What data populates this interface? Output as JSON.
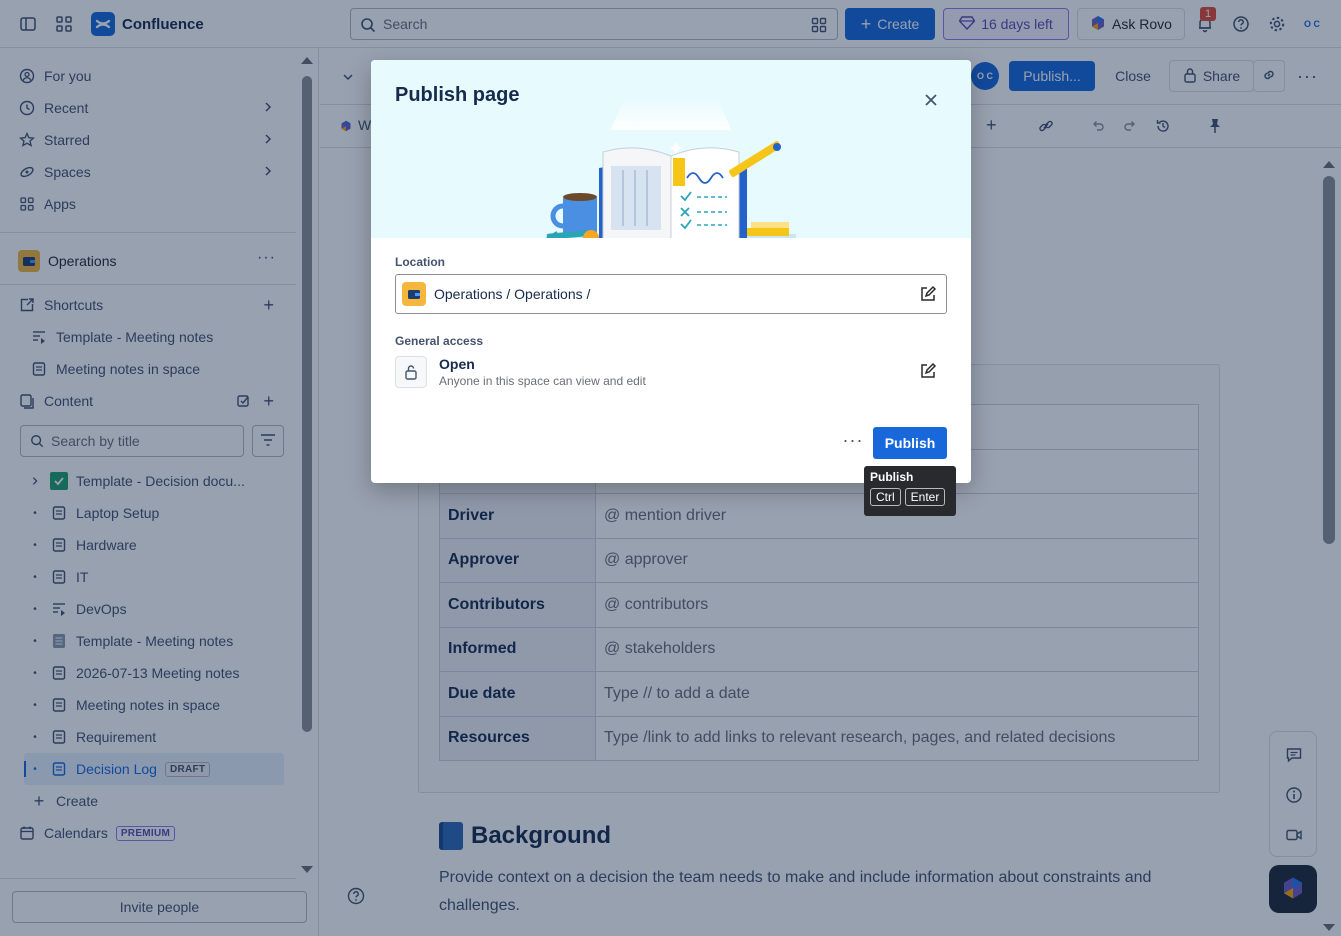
{
  "app": {
    "name": "Confluence"
  },
  "topbar": {
    "search_placeholder": "Search",
    "create_label": "Create",
    "trial_label": "16 days left",
    "rovo_label": "Ask Rovo",
    "notification_count": "1",
    "avatar_initials": "O C"
  },
  "sidebar": {
    "nav": [
      {
        "label": "For you"
      },
      {
        "label": "Recent"
      },
      {
        "label": "Starred"
      },
      {
        "label": "Spaces"
      },
      {
        "label": "Apps"
      }
    ],
    "space_name": "Operations",
    "shortcuts_label": "Shortcuts",
    "shortcuts": [
      {
        "label": "Template - Meeting notes"
      },
      {
        "label": "Meeting notes in space"
      }
    ],
    "content_label": "Content",
    "search_placeholder": "Search by title",
    "tree": [
      {
        "label": "Template - Decision docu..."
      },
      {
        "label": "Laptop Setup"
      },
      {
        "label": "Hardware"
      },
      {
        "label": "IT"
      },
      {
        "label": "DevOps"
      },
      {
        "label": "Template - Meeting notes"
      },
      {
        "label": "2026-07-13 Meeting notes"
      },
      {
        "label": "Meeting notes in space"
      },
      {
        "label": "Requirement"
      },
      {
        "label": "Decision Log",
        "badge": "DRAFT"
      }
    ],
    "create_label": "Create",
    "calendars_label": "Calendars",
    "calendars_badge": "PREMIUM",
    "invite_label": "Invite people"
  },
  "editor": {
    "publish_label": "Publish...",
    "close_label": "Close",
    "share_label": "Share",
    "toolbar_first_letter": "W",
    "table": [
      {
        "key": "",
        "value": ""
      },
      {
        "key": "",
        "value": ""
      },
      {
        "key": "Driver",
        "value": "@ mention driver"
      },
      {
        "key": "Approver",
        "value": "@ approver"
      },
      {
        "key": "Contributors",
        "value": "@ contributors"
      },
      {
        "key": "Informed",
        "value": "@ stakeholders"
      },
      {
        "key": "Due date",
        "value": "Type // to add a date"
      },
      {
        "key": "Resources",
        "value": "Type /link to add links to relevant research, pages, and related decisions"
      }
    ],
    "background_heading": "Background",
    "background_text": "Provide context on a decision the team needs to make and include information about constraints and challenges."
  },
  "modal": {
    "title": "Publish page",
    "location_label": "Location",
    "location_value": "Operations / Operations /",
    "access_label": "General access",
    "access_title": "Open",
    "access_sub": "Anyone in this space can view and edit",
    "publish_label": "Publish"
  },
  "tooltip": {
    "title": "Publish",
    "keys": [
      "Ctrl",
      "Enter"
    ]
  },
  "colors": {
    "brand_blue": "#1868db",
    "trial_purple": "#5e4db2",
    "hero_bg": "#e7fafe"
  }
}
